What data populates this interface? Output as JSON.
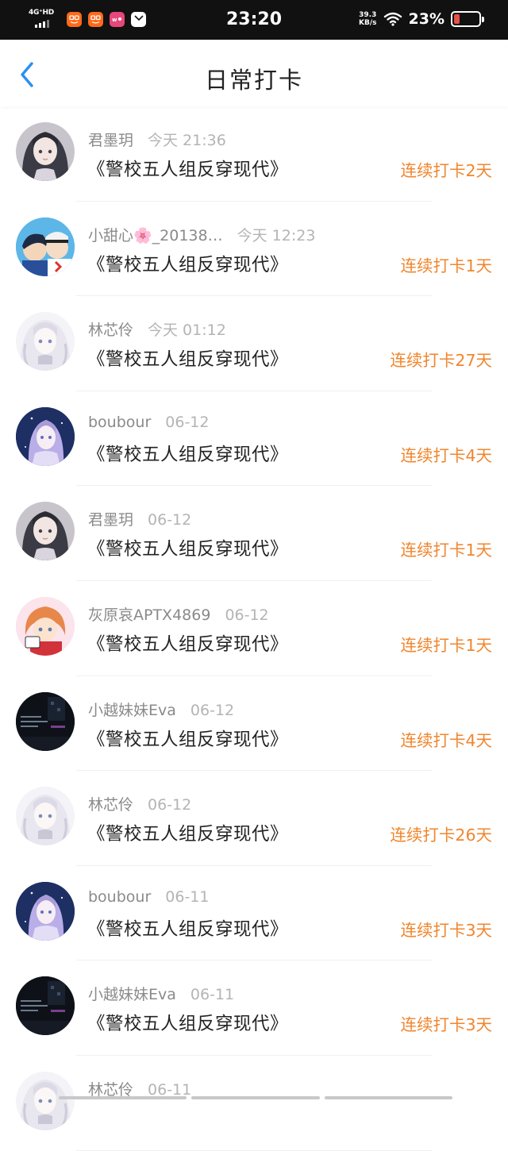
{
  "status_bar": {
    "network": "4G⁺HD",
    "time": "23:20",
    "speed_value": "39.3",
    "speed_unit": "KB/s",
    "battery_pct": "23%",
    "battery_level": 0.23,
    "app_icons": [
      {
        "icon": "taobao-icon",
        "color": "#ff6a1a"
      },
      {
        "icon": "taobao-icon",
        "color": "#ff6a1a"
      },
      {
        "icon": "app-icon",
        "color": "#e9467c"
      },
      {
        "icon": "mail-icon",
        "color": "#ffffff"
      }
    ]
  },
  "header": {
    "back_icon": "chevron-left-icon",
    "title": "日常打卡"
  },
  "colors": {
    "accent_blue": "#2b8ff2",
    "streak_orange": "#f0862e"
  },
  "checkins": [
    {
      "name": "君墨玥",
      "time": "今天 21:36",
      "book": "《警校五人组反穿现代》",
      "streak": "连续打卡2天",
      "avatar": "dark-hair-girl"
    },
    {
      "name": "小甜心🌸_20138…",
      "time": "今天 12:23",
      "book": "《警校五人组反穿现代》",
      "streak": "连续打卡1天",
      "avatar": "anime-duo"
    },
    {
      "name": "林芯伶",
      "time": "今天 01:12",
      "book": "《警校五人组反穿现代》",
      "streak": "连续打卡27天",
      "avatar": "white-hair-girl"
    },
    {
      "name": "boubour",
      "time": "06-12",
      "book": "《警校五人组反穿现代》",
      "streak": "连续打卡4天",
      "avatar": "blue-night-girl"
    },
    {
      "name": "君墨玥",
      "time": "06-12",
      "book": "《警校五人组反穿现代》",
      "streak": "连续打卡1天",
      "avatar": "dark-hair-girl"
    },
    {
      "name": "灰原哀APTX4869",
      "time": "06-12",
      "book": "《警校五人组反穿现代》",
      "streak": "连续打卡1天",
      "avatar": "orange-hair-girl"
    },
    {
      "name": "小越妹妹Eva",
      "time": "06-12",
      "book": "《警校五人组反穿现代》",
      "streak": "连续打卡4天",
      "avatar": "dark-screen"
    },
    {
      "name": "林芯伶",
      "time": "06-12",
      "book": "《警校五人组反穿现代》",
      "streak": "连续打卡26天",
      "avatar": "white-hair-girl"
    },
    {
      "name": "boubour",
      "time": "06-11",
      "book": "《警校五人组反穿现代》",
      "streak": "连续打卡3天",
      "avatar": "blue-night-girl"
    },
    {
      "name": "小越妹妹Eva",
      "time": "06-11",
      "book": "《警校五人组反穿现代》",
      "streak": "连续打卡3天",
      "avatar": "dark-screen"
    },
    {
      "name": "林芯伶",
      "time": "06-11",
      "book": "",
      "streak": "",
      "avatar": "white-hair-girl"
    }
  ]
}
